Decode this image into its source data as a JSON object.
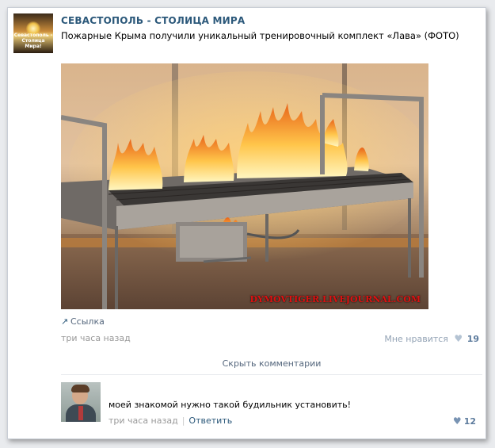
{
  "post": {
    "group_name": "СЕВАСТОПОЛЬ - СТОЛИЦА МИРА",
    "avatar_caption": "Севастополь - Столица Мира!",
    "text": "Пожарные Крыма получили уникальный тренировочный комплект «Лава» (ФОТО)",
    "image_watermark": "DYMOVTIGER.LIVEJOURNAL.COM",
    "link_label": "Ссылка",
    "timestamp": "три часа назад",
    "like_label": "Мне нравится",
    "like_count": "19",
    "hide_comments_label": "Скрыть комментарии"
  },
  "comment": {
    "text": "моей знакомой нужно такой будильник установить!",
    "timestamp": "три часа назад",
    "reply_label": "Ответить",
    "like_count": "12"
  },
  "icons": {
    "link": "link-arrow-icon",
    "heart": "heart-icon"
  },
  "colors": {
    "link_blue": "#2b587a",
    "meta_gray": "#999999",
    "heart": "#b4c3d3"
  }
}
